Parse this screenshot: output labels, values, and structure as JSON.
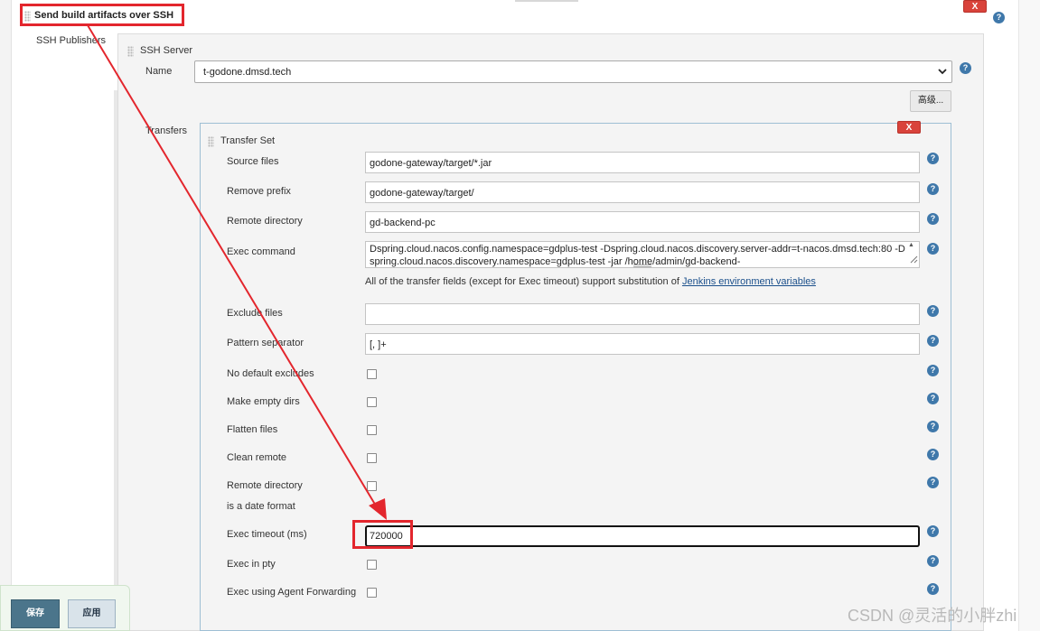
{
  "section": {
    "title": "Send build artifacts over SSH",
    "publishers_label": "SSH Publishers"
  },
  "server": {
    "title": "SSH Server",
    "name_label": "Name",
    "name_value": "t-godone.dmsd.tech",
    "advanced_label": "高级..."
  },
  "transfers": {
    "label": "Transfers",
    "set_title": "Transfer Set",
    "delete_label": "X",
    "fields": {
      "source_files": {
        "label": "Source files",
        "value": "godone-gateway/target/*.jar"
      },
      "remove_prefix": {
        "label": "Remove prefix",
        "value": "godone-gateway/target/"
      },
      "remote_directory": {
        "label": "Remote directory",
        "value": "gd-backend-pc"
      },
      "exec_command": {
        "label": "Exec command",
        "value": "Dspring.cloud.nacos.config.namespace=gdplus-test -Dspring.cloud.nacos.discovery.server-addr=t-nacos.dmsd.tech:80 -Dspring.cloud.nacos.discovery.namespace=gdplus-test -jar /home/admin/gd-backend-"
      },
      "exclude_files": {
        "label": "Exclude files",
        "value": ""
      },
      "pattern_separator": {
        "label": "Pattern separator",
        "value": "[, ]+"
      },
      "exec_timeout": {
        "label": "Exec timeout (ms)",
        "value": "720000"
      }
    },
    "note_text": "All of the transfer fields (except for Exec timeout) support substitution of ",
    "note_link": "Jenkins environment variables",
    "checkboxes": {
      "no_default_excludes": "No default excludes",
      "make_empty_dirs": "Make empty dirs",
      "flatten_files": "Flatten files",
      "clean_remote": "Clean remote",
      "remote_dir_date_line1": "Remote directory",
      "remote_dir_date_line2": "is a date format",
      "exec_in_pty": "Exec in pty",
      "agent_forwarding": "Exec using Agent Forwarding"
    }
  },
  "buttons": {
    "save": "保存",
    "apply": "应用",
    "delete": "X",
    "help": "?"
  },
  "watermark": "CSDN @灵活的小胖zhi",
  "colors": {
    "highlight": "#e3262d",
    "help": "#3f78aa",
    "delete": "#d9433b",
    "link": "#1a4f8b"
  }
}
